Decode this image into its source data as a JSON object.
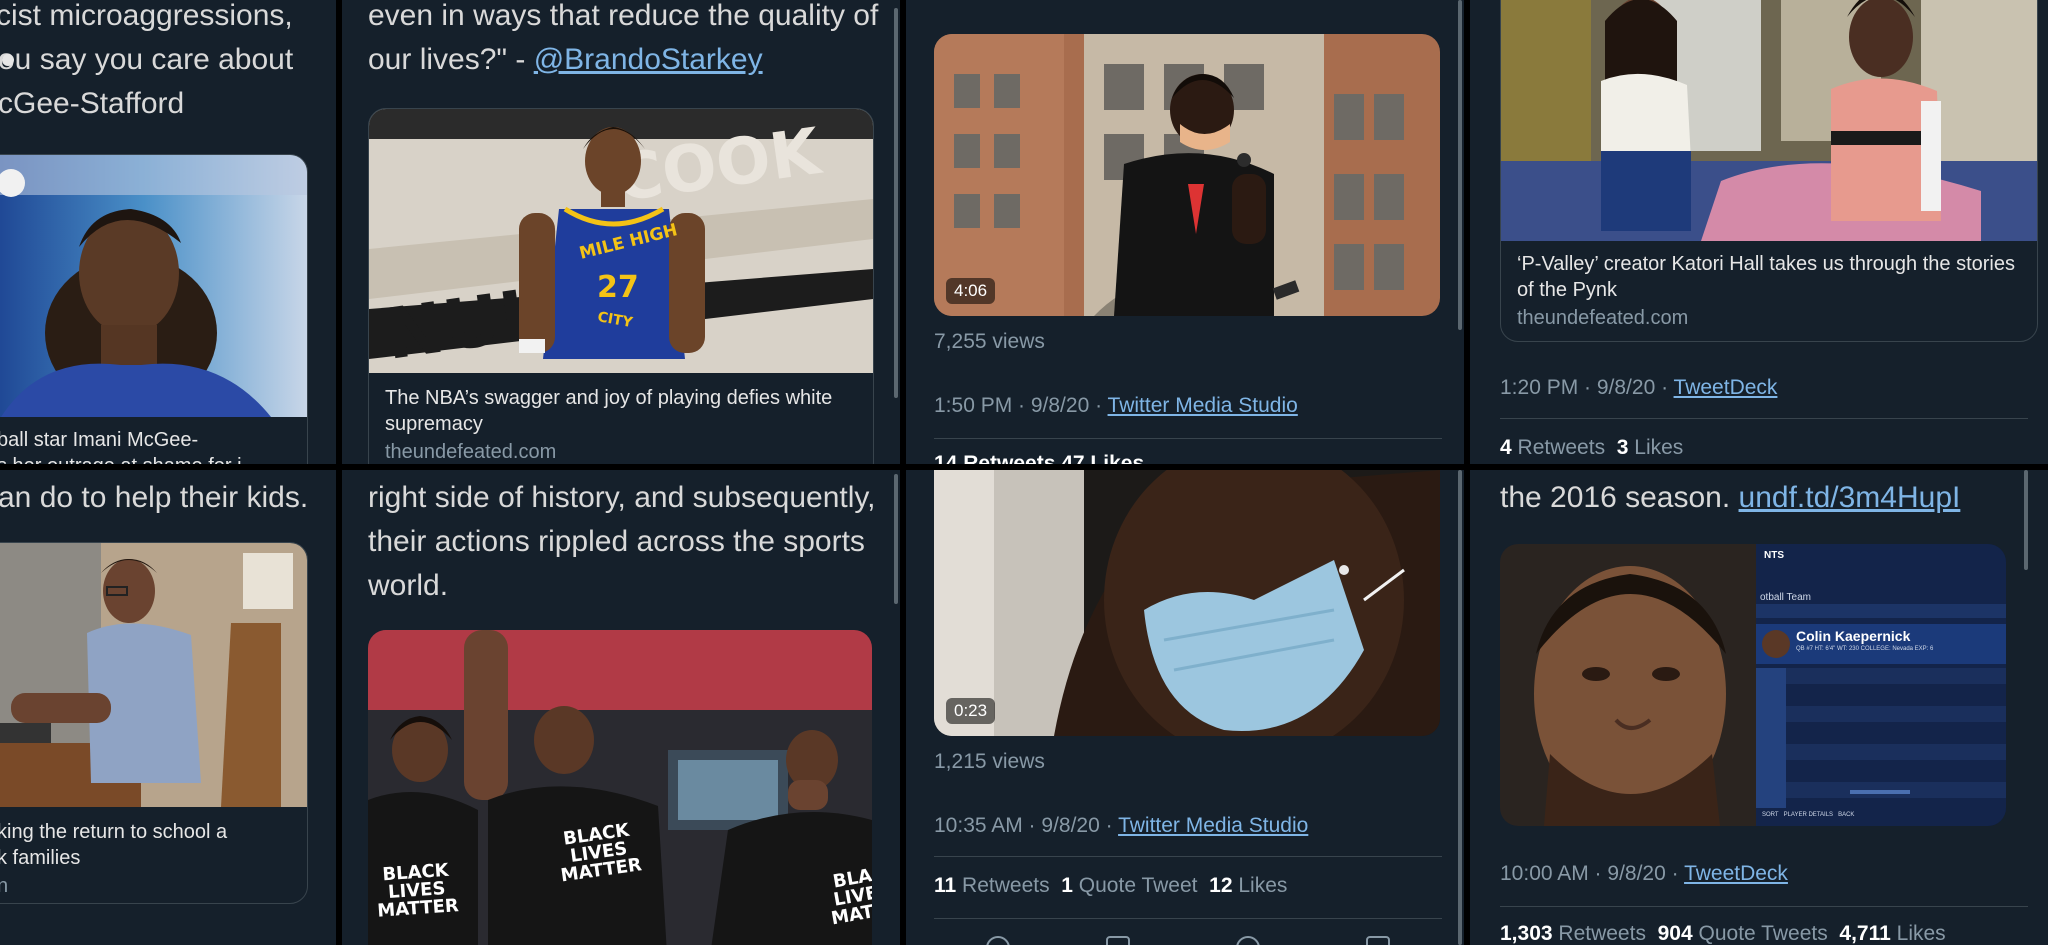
{
  "t1": {
    "text_lines": [
      "cist microaggressions,",
      "ou say you care about",
      "cGee-Stafford"
    ],
    "card_title_lines": [
      "ball star Imani McGee-",
      "s her outrage at shame for i"
    ]
  },
  "t2": {
    "text_line1": "even in ways that reduce the quality of",
    "text_line2_prefix": "our lives?\" - ",
    "mention": "@BrandoStarkey",
    "jersey_top": "MILE HIGH",
    "jersey_num": "27",
    "jersey_city": "CITY",
    "card_title": "The NBA’s swagger and joy of playing defies white supremacy",
    "card_domain": "theundefeated.com"
  },
  "t3": {
    "duration": "4:06",
    "views": "7,255 views",
    "time": "1:50 PM · 9/8/20 · ",
    "source": "Twitter Media Studio",
    "cut_stats": "14 Retweets  47 Likes"
  },
  "t4": {
    "card_title": "‘P-Valley’ creator Katori Hall takes us through the stories of the Pynk",
    "card_domain": "theundefeated.com",
    "time": "1:20 PM · 9/8/20 · ",
    "source": "TweetDeck",
    "retweets": "4",
    "retweets_label": "Retweets",
    "likes": "3",
    "likes_label": "Likes"
  },
  "t5": {
    "text": "an do to help their kids.",
    "card_title_lines": [
      "king the return to school a",
      "k families"
    ],
    "card_domain": "n"
  },
  "t6": {
    "text_lines": [
      "right side of history, and subsequently,",
      "their actions rippled across the sports",
      "world."
    ],
    "shirt_left": "BLACK\nLIVES\nMATTER",
    "shirt_center": "BLACK\nLIVES\nMATTER",
    "shirt_right": "BLA\nLIVE\nMATT"
  },
  "t7": {
    "duration": "0:23",
    "views": "1,215 views",
    "time": "10:35 AM · 9/8/20 · ",
    "source": "Twitter Media Studio",
    "retweets": "11",
    "retweets_label": "Retweets",
    "quotes": "1",
    "quotes_label": "Quote Tweet",
    "likes": "12",
    "likes_label": "Likes"
  },
  "t8": {
    "text_prefix": "the 2016 season. ",
    "link": "undf.td/3m4HupI",
    "panel_header": "NTS",
    "panel_team": "otball Team",
    "player_name": "Colin Kaepernick",
    "player_sub": "QB #7   HT: 6'4\"   WT: 230   COLLEGE: Nevada   EXP: 6",
    "footer_1": "SORT",
    "footer_2": "PLAYER DETAILS",
    "footer_3": "BACK",
    "time": "10:00 AM · 9/8/20 · ",
    "source": "TweetDeck",
    "retweets": "1,303",
    "retweets_label": "Retweets",
    "quotes": "904",
    "quotes_label": "Quote Tweets",
    "likes": "4,711",
    "likes_label": "Likes"
  },
  "colors": {
    "background": "#15202b",
    "link": "#7fb5e6",
    "muted": "#8899a6",
    "divider": "#000000"
  }
}
